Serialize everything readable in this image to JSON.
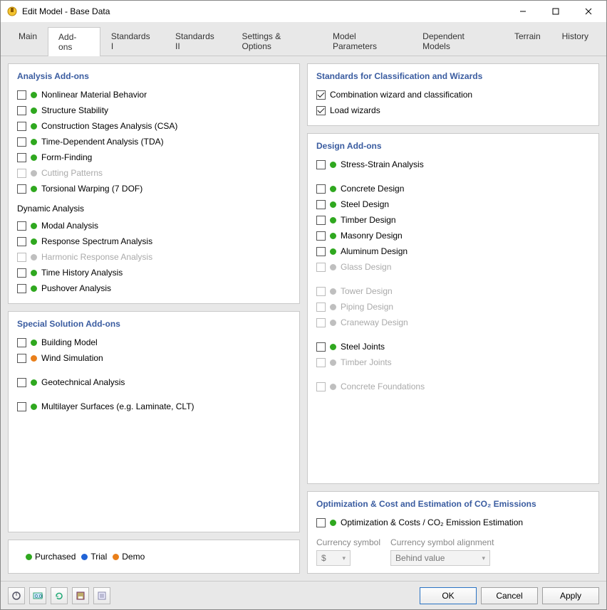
{
  "window": {
    "title": "Edit Model - Base Data"
  },
  "tabs": [
    {
      "label": "Main"
    },
    {
      "label": "Add-ons",
      "active": true
    },
    {
      "label": "Standards I"
    },
    {
      "label": "Standards II"
    },
    {
      "label": "Settings & Options"
    },
    {
      "label": "Model Parameters"
    },
    {
      "label": "Dependent Models"
    },
    {
      "label": "Terrain"
    },
    {
      "label": "History"
    }
  ],
  "analysis_addons": {
    "heading": "Analysis Add-ons",
    "items": [
      {
        "label": "Nonlinear Material Behavior",
        "dot": "green"
      },
      {
        "label": "Structure Stability",
        "dot": "green"
      },
      {
        "label": "Construction Stages Analysis (CSA)",
        "dot": "green"
      },
      {
        "label": "Time-Dependent Analysis (TDA)",
        "dot": "green"
      },
      {
        "label": "Form-Finding",
        "dot": "green"
      },
      {
        "label": "Cutting Patterns",
        "dot": "grey",
        "disabled": true
      },
      {
        "label": "Torsional Warping (7 DOF)",
        "dot": "green"
      }
    ],
    "sub_heading": "Dynamic Analysis",
    "sub_items": [
      {
        "label": "Modal Analysis",
        "dot": "green"
      },
      {
        "label": "Response Spectrum Analysis",
        "dot": "green"
      },
      {
        "label": "Harmonic Response Analysis",
        "dot": "grey",
        "disabled": true
      },
      {
        "label": "Time History Analysis",
        "dot": "green"
      },
      {
        "label": "Pushover Analysis",
        "dot": "green"
      }
    ]
  },
  "special_solution": {
    "heading": "Special Solution Add-ons",
    "groups": [
      [
        {
          "label": "Building Model",
          "dot": "green"
        },
        {
          "label": "Wind Simulation",
          "dot": "orange"
        }
      ],
      [
        {
          "label": "Geotechnical Analysis",
          "dot": "green"
        }
      ],
      [
        {
          "label": "Multilayer Surfaces (e.g. Laminate, CLT)",
          "dot": "green"
        }
      ]
    ]
  },
  "standards_wizards": {
    "heading": "Standards for Classification and Wizards",
    "items": [
      {
        "label": "Combination wizard and classification",
        "checked": true
      },
      {
        "label": "Load wizards",
        "checked": true
      }
    ]
  },
  "design_addons": {
    "heading": "Design Add-ons",
    "groups": [
      [
        {
          "label": "Stress-Strain Analysis",
          "dot": "green"
        }
      ],
      [
        {
          "label": "Concrete Design",
          "dot": "green"
        },
        {
          "label": "Steel Design",
          "dot": "green"
        },
        {
          "label": "Timber Design",
          "dot": "green"
        },
        {
          "label": "Masonry Design",
          "dot": "green"
        },
        {
          "label": "Aluminum Design",
          "dot": "green"
        },
        {
          "label": "Glass Design",
          "dot": "grey",
          "disabled": true
        }
      ],
      [
        {
          "label": "Tower Design",
          "dot": "grey",
          "disabled": true
        },
        {
          "label": "Piping Design",
          "dot": "grey",
          "disabled": true
        },
        {
          "label": "Craneway Design",
          "dot": "grey",
          "disabled": true
        }
      ],
      [
        {
          "label": "Steel Joints",
          "dot": "green"
        },
        {
          "label": "Timber Joints",
          "dot": "grey",
          "disabled": true
        }
      ],
      [
        {
          "label": "Concrete Foundations",
          "dot": "grey",
          "disabled": true
        }
      ]
    ]
  },
  "optimization": {
    "heading": "Optimization & Cost and Estimation of CO₂ Emissions",
    "item": {
      "label": "Optimization & Costs / CO₂ Emission Estimation",
      "dot": "green"
    },
    "currency_label": "Currency symbol",
    "currency_value": "$",
    "align_label": "Currency symbol alignment",
    "align_value": "Behind value"
  },
  "legend": {
    "purchased": "Purchased",
    "trial": "Trial",
    "demo": "Demo"
  },
  "buttons": {
    "ok": "OK",
    "cancel": "Cancel",
    "apply": "Apply"
  }
}
